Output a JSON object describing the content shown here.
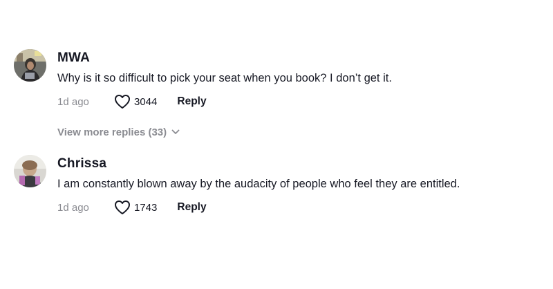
{
  "comments": [
    {
      "username": "MWA",
      "text": "Why is it so difficult to pick your seat when you book? I don’t get it.",
      "time": "1d ago",
      "likes": "3044",
      "reply_label": "Reply",
      "view_more_replies": "View more replies (33)"
    },
    {
      "username": "Chrissa",
      "text": "I am constantly blown away by the audacity of people who feel they are entitled.",
      "time": "1d ago",
      "likes": "1743",
      "reply_label": "Reply"
    }
  ],
  "icons": {
    "like": "heart-outline-icon",
    "expand": "chevron-down-icon"
  },
  "colors": {
    "primary_text": "#161823",
    "secondary_text": "#8a8b91",
    "background": "#ffffff"
  }
}
